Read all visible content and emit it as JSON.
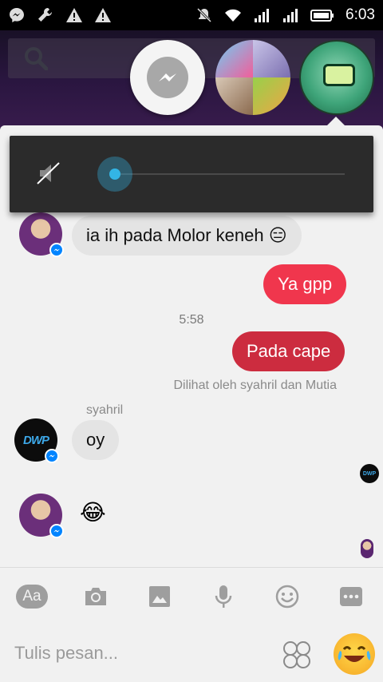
{
  "status_bar": {
    "time": "6:03",
    "left_icons": [
      "messenger-icon",
      "wrench-icon",
      "warning-icon",
      "warning-icon"
    ],
    "right_icons": [
      "mute-bell-icon",
      "wifi-icon",
      "signal-icon",
      "signal-icon",
      "battery-icon"
    ]
  },
  "volume": {
    "level": 0.0
  },
  "messages": [
    {
      "sender": "Mutia",
      "direction": "in",
      "text": "ia ih pada Molor keneh 😑"
    },
    {
      "direction": "out",
      "text": "Ya gpp"
    },
    {
      "timestamp": "5:58"
    },
    {
      "direction": "out",
      "text": "Pada cape"
    },
    {
      "seen": "Dilihat oleh syahril dan Mutia"
    },
    {
      "sender_name": "syahril",
      "direction": "in",
      "text": "oy"
    },
    {
      "direction": "in",
      "text": "😂"
    }
  ],
  "avatar_dwp_text": "DWP",
  "toolbar": {
    "aa_label": "Aa",
    "buttons": [
      "text-style-button",
      "camera-button",
      "gallery-button",
      "microphone-button",
      "emoji-smile-button",
      "more-button"
    ]
  },
  "composer": {
    "placeholder": "Tulis pesan...",
    "value": ""
  },
  "colors": {
    "outgoing": "#f0364d",
    "outgoing_last": "#cc2c3f",
    "incoming": "#e4e4e4",
    "messenger_blue": "#0084ff",
    "volume_accent": "#33b5e5"
  }
}
